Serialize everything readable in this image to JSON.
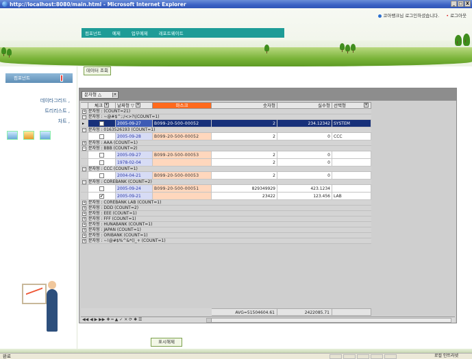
{
  "window": {
    "title": "http://localhost:8080/main.html - Microsoft Internet Explorer",
    "controls": [
      "_",
      "□",
      "X"
    ]
  },
  "header": {
    "welcome": "코아뱅크님 로그인하셨습니다.",
    "logout": "로그아웃",
    "menu": [
      "컴포넌트",
      "예제",
      "업무예제",
      "레포트웨이트"
    ]
  },
  "sidebar": {
    "section": "컴포넌트",
    "items": [
      "데이타그리드 ,",
      "트리리스트 ,",
      "차트 ,"
    ]
  },
  "main": {
    "query_button": "데이터 조회",
    "reset_button": "표시해제",
    "group_pill": "문자형",
    "columns": {
      "check": "체크",
      "date": "날짜형",
      "disk": "마스크",
      "number": "숫자형",
      "real": "실수형",
      "select": "선택형"
    },
    "rows": [
      {
        "kind": "group",
        "expanded": false,
        "text": "문자형 : (COUNT=21)"
      },
      {
        "kind": "group",
        "expanded": true,
        "text": "문자형 : ~@#$^;:/<>?\\(COUNT=1)"
      },
      {
        "kind": "data",
        "selected": true,
        "checked": false,
        "date": "2005-09-27",
        "disk": "B099-20-500-00052",
        "number": "2",
        "real": "234.12342",
        "select": "SYSTEM"
      },
      {
        "kind": "group",
        "expanded": true,
        "text": "문자형 : 0163526193 (COUNT=1)"
      },
      {
        "kind": "data",
        "checked": false,
        "date": "2005-09-28",
        "disk": "B099-20-500-00052",
        "number": "2",
        "real": "0",
        "select": "CCC"
      },
      {
        "kind": "group",
        "expanded": false,
        "text": "문자형 : AAA (COUNT=1)"
      },
      {
        "kind": "group",
        "expanded": true,
        "text": "문자형 : BBB (COUNT=2)"
      },
      {
        "kind": "data",
        "checked": false,
        "date": "2005-09-27",
        "disk": "B099-20-500-00053",
        "number": "2",
        "real": "0",
        "select": ""
      },
      {
        "kind": "data",
        "checked": false,
        "date": "1978-02-04",
        "disk": "",
        "number": "2",
        "real": "0",
        "select": ""
      },
      {
        "kind": "group",
        "expanded": true,
        "text": "문자형 : CCC (COUNT=1)"
      },
      {
        "kind": "data",
        "checked": false,
        "date": "2004-04-21",
        "disk": "B099-20-500-00053",
        "number": "2",
        "real": "0",
        "select": ""
      },
      {
        "kind": "group",
        "expanded": true,
        "text": "문자형 : COREBANK (COUNT=2)"
      },
      {
        "kind": "data",
        "checked": false,
        "date": "2005-09-24",
        "disk": "B099-20-500-00051",
        "number": "829349929",
        "real": "423.1234",
        "select": ""
      },
      {
        "kind": "data",
        "checked": true,
        "date": "2005-09-21",
        "disk": "",
        "number": "23422",
        "real": "123.456",
        "select": "LAB"
      },
      {
        "kind": "group",
        "expanded": false,
        "text": "문자형 : COREBANK LAB (COUNT=1)"
      },
      {
        "kind": "group",
        "expanded": false,
        "text": "문자형 : DDD (COUNT=2)"
      },
      {
        "kind": "group",
        "expanded": false,
        "text": "문자형 : EEE (COUNT=1)"
      },
      {
        "kind": "group",
        "expanded": false,
        "text": "문자형 : FFF (COUNT=1)"
      },
      {
        "kind": "group",
        "expanded": false,
        "text": "문자형 : HUNABANK (COUNT=1)"
      },
      {
        "kind": "group",
        "expanded": false,
        "text": "문자형 : JAPAN (COUNT=1)"
      },
      {
        "kind": "group",
        "expanded": false,
        "text": "문자형 : ORIBANK (COUNT=1)"
      },
      {
        "kind": "group",
        "expanded": false,
        "text": "문자형 : ~!@#$%^&*()_+ (COUNT=1)"
      }
    ],
    "footer": {
      "number_avg": "AVG=51504604.61",
      "real_sum": "2422085.71"
    },
    "navbar": "◀◀ ◀ ▶ ▶▶ ✚ ━ ▲ ✓ ✕ ⟳ ✱ ☰"
  },
  "statusbar": {
    "text": "완료",
    "zone": "로컬 인트라넷"
  },
  "colors": {
    "menu_bg": "#1e9c97",
    "disk_header": "#ff6a1d",
    "selected_row": "#17307a"
  }
}
